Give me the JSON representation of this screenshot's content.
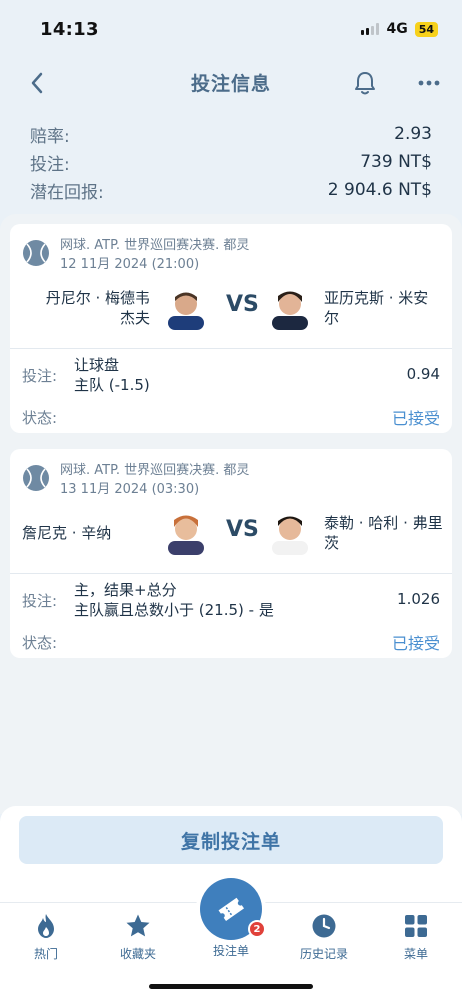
{
  "status_bar": {
    "time": "14:13",
    "network": "4G",
    "battery": "54"
  },
  "header": {
    "title": "投注信息"
  },
  "summary": {
    "odds_label": "赔率:",
    "odds_value": "2.93",
    "stake_label": "投注:",
    "stake_value": "739 NT$",
    "return_label": "潜在回报:",
    "return_value": "2 904.6 NT$"
  },
  "bets": [
    {
      "league": "网球. ATP. 世界巡回赛决赛. 都灵",
      "date": "12 11月 2024 (21:00)",
      "team1_line1": "丹尼尔 · 梅德韦",
      "team1_line2": "杰夫",
      "vs": "VS",
      "team2_line1": "亚历克斯 · 米安",
      "team2_line2": "尔",
      "bet_label": "投注:",
      "bet_market": "让球盘",
      "bet_selection": "主队 (-1.5)",
      "odds": "0.94",
      "state_label": "状态:",
      "state": "已接受"
    },
    {
      "league": "网球. ATP. 世界巡回赛决赛. 都灵",
      "date": "13 11月 2024 (03:30)",
      "team1_line1": "詹尼克 · 辛纳",
      "team1_line2": "",
      "vs": "VS",
      "team2_line1": "泰勒 · 哈利 · 弗里",
      "team2_line2": "茨",
      "bet_label": "投注:",
      "bet_market": "主，结果+总分",
      "bet_selection": "主队赢且总数小于 (21.5) - 是",
      "odds": "1.026",
      "state_label": "状态:",
      "state": "已接受"
    }
  ],
  "copy_button": "复制投注单",
  "tabs": {
    "hot": "热门",
    "favorites": "收藏夹",
    "betslip": "投注单",
    "betslip_badge": "2",
    "history": "历史记录",
    "menu": "菜单"
  },
  "colors": {
    "accent": "#3f7fbd",
    "accepted": "#4a8fd0",
    "badge": "#e0413a"
  }
}
